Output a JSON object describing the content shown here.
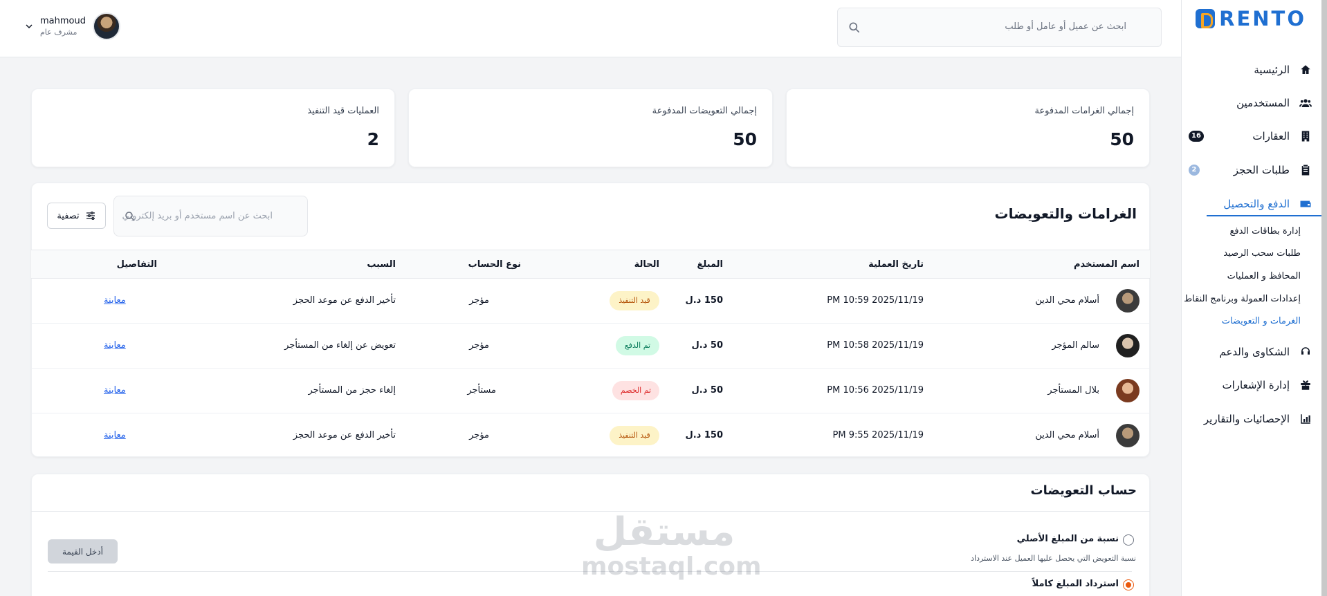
{
  "brand": {
    "name": "RENTO"
  },
  "topbar": {
    "search_placeholder": "ابحث عن عميل أو عامل أو طلب",
    "user_name": "mahmoud",
    "user_role": "مشرف عام"
  },
  "sidebar": {
    "items": [
      {
        "label": "الرئيسية",
        "icon": "home-icon"
      },
      {
        "label": "المستخدمين",
        "icon": "users-icon"
      },
      {
        "label": "العقارات",
        "icon": "building-icon",
        "badge": "16"
      },
      {
        "label": "طلبات الحجز",
        "icon": "clipboard-icon",
        "badge": "2"
      },
      {
        "label": "الدفع والتحصيل",
        "icon": "wallet-icon",
        "active": true
      },
      {
        "label": "الشكاوى والدعم",
        "icon": "headset-icon"
      },
      {
        "label": "إدارة الإشعارات",
        "icon": "gift-icon"
      },
      {
        "label": "الإحصائيات والتقارير",
        "icon": "chart-icon"
      }
    ],
    "sub_items": [
      {
        "label": "إدارة بطاقات الدفع"
      },
      {
        "label": "طلبات سحب الرصيد"
      },
      {
        "label": "المحافظ و العمليات"
      },
      {
        "label": "إعدادات العمولة وبرنامج النقاط"
      },
      {
        "label": "الغرمات و التعويضات",
        "active": true
      }
    ]
  },
  "stats": [
    {
      "title": "إجمالي الغرامات المدفوعة",
      "value": "50"
    },
    {
      "title": "إجمالي التعويضات المدفوعة",
      "value": "50"
    },
    {
      "title": "العمليات قيد التنفيذ",
      "value": "2"
    }
  ],
  "fines": {
    "title": "الغرامات والتعويضات",
    "search_placeholder": "ابحث عن اسم مستخدم أو بريد إلكتروني",
    "filter_label": "تصفية",
    "columns": [
      "اسم المستخدم",
      "تاريخ العملية",
      "المبلغ",
      "الحالة",
      "نوع الحساب",
      "السبب",
      "التفاصيل"
    ],
    "rows": [
      {
        "name": "أسلام محي الدين",
        "date": "PM 10:59 2025/11/19",
        "amount": "150 د.ل",
        "status": "قيد التنفيذ",
        "status_type": "pending",
        "account": "مؤجر",
        "reason": "تأخير الدفع عن موعد الحجز",
        "details": "معاينة"
      },
      {
        "name": "سالم المؤجر",
        "date": "PM 10:58 2025/11/19",
        "amount": "50 د.ل",
        "status": "تم الدفع",
        "status_type": "paid",
        "account": "مؤجر",
        "reason": "تعويض عن إلغاء من المستأجر",
        "details": "معاينة"
      },
      {
        "name": "بلال المستأجر",
        "date": "PM 10:56 2025/11/19",
        "amount": "50 د.ل",
        "status": "تم الخصم",
        "status_type": "deducted",
        "account": "مستأجر",
        "reason": "إلغاء حجز من المستأجر",
        "details": "معاينة"
      },
      {
        "name": "أسلام محي الدين",
        "date": "PM 9:55 2025/11/19",
        "amount": "150 د.ل",
        "status": "قيد التنفيذ",
        "status_type": "pending",
        "account": "مؤجر",
        "reason": "تأخير الدفع عن موعد الحجز",
        "details": "معاينة"
      }
    ]
  },
  "compensation": {
    "title": "حساب التعويضات",
    "options": [
      {
        "label": "نسبة من المبلغ الأصلي",
        "desc": "نسبة التعويض التي يحصل عليها العميل عند الاسترداد",
        "checked": false
      },
      {
        "label": "استرداد المبلغ كاملاً",
        "checked": true
      }
    ],
    "value_button": "أدخل القيمة"
  },
  "watermark": {
    "ar": "مستقل",
    "en": "mostaql.com"
  },
  "colors": {
    "accent": "#1f6fd1",
    "pending": "#fdf3c7",
    "paid": "#d1fae5",
    "deducted": "#fee2e2",
    "radio": "#ea580c"
  }
}
